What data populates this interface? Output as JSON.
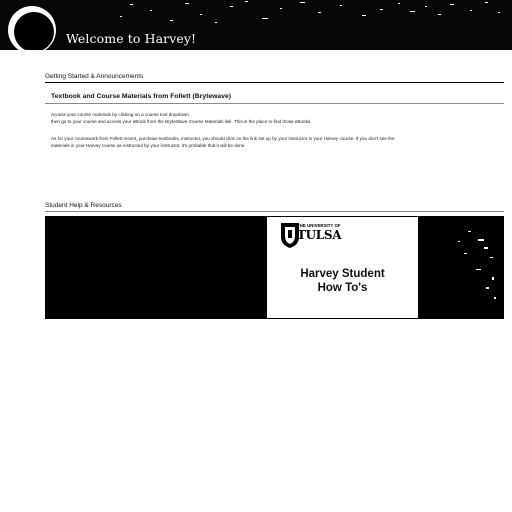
{
  "banner": {
    "title": "Welcome to Harvey!"
  },
  "announcements": {
    "heading": "Getting Started & Announcements",
    "title": "Textbook and Course Materials from Follett (Brytewave)",
    "lines": [
      "Access your course materials by clicking on a course tool dropdown",
      "then go to your course and access your eBook from the BryteWave Course Materials link. This is the place to find those eBooks.",
      "As for your coursework from Follett recent, purchase textbooks, instructor, you should click on the link set up by your instructor in your Harvey course. If you don't see the",
      "materials in your Harvey course as instructed by your instructor, it's probable that it will be done."
    ]
  },
  "resources": {
    "heading": "Student Help & Resources",
    "card": {
      "logo_top": "THE UNIVERSITY OF",
      "logo_main": "TULSA",
      "title_line1": "Harvey Student",
      "title_line2": "How To's"
    }
  },
  "colors": {
    "banner_bg": "#060606",
    "banner_text": "#ffffff",
    "page_bg": "#ffffff"
  },
  "icons": {
    "banner_emblem": "circle-emblem",
    "tulsa_logo": "tulsa-shield-logo"
  }
}
